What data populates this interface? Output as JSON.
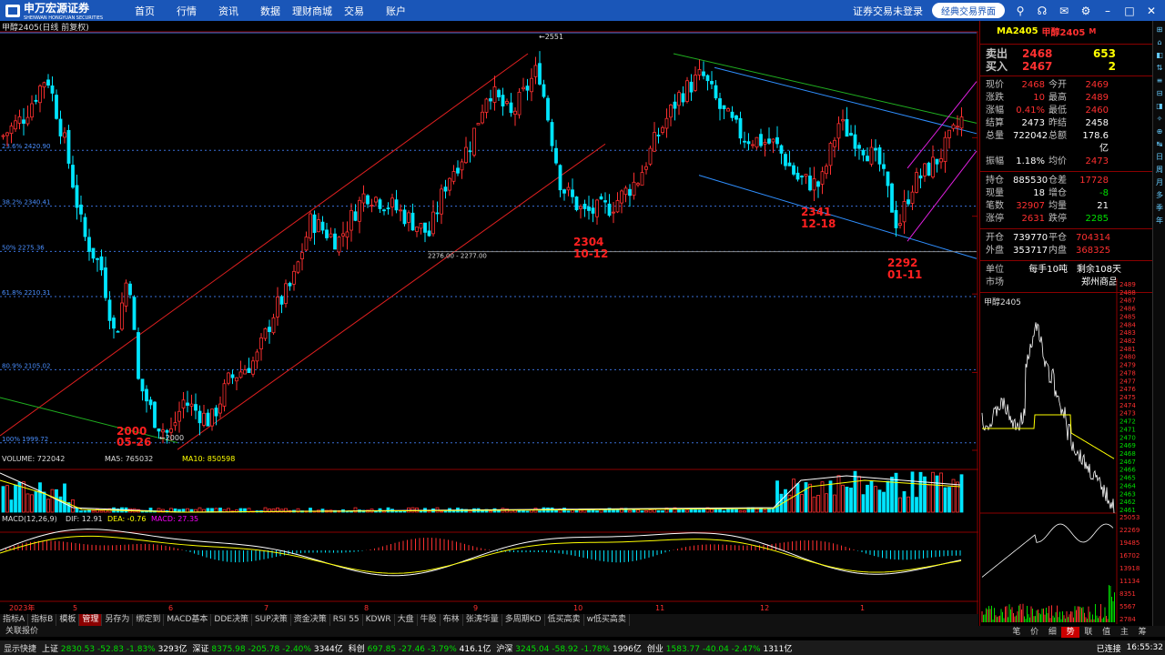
{
  "header": {
    "logo": "申万宏源证券",
    "logo_sub": "SHENWAN HONGYUAN SECURITIES",
    "nav": [
      "首页",
      "行情",
      "资讯",
      "数据",
      "理财商城",
      "交易",
      "账户"
    ],
    "login_status": "证券交易未登录",
    "classic_button": "经典交易界面",
    "icons": [
      "search-icon",
      "headset-icon",
      "mail-icon",
      "gear-icon",
      "minimize-icon",
      "maximize-icon",
      "close-icon"
    ]
  },
  "chart": {
    "info": "甲醇2405(日线 前复权)",
    "fib_levels": [
      {
        "label": "23.6% 2420.90",
        "price": 2420.9
      },
      {
        "label": "38.2% 2340.41",
        "price": 2340.41
      },
      {
        "label": "50% 2275.36",
        "price": 2275.36
      },
      {
        "label": "61.8% 2210.31",
        "price": 2210.31
      },
      {
        "label": "80.9% 2105.02",
        "price": 2105.02
      },
      {
        "label": "100% 1999.72",
        "price": 1999.72
      }
    ],
    "right_axis": [
      {
        "label": "2439",
        "price": 2439
      },
      {
        "label": "2326",
        "price": 2326
      },
      {
        "label": "2214",
        "price": 2214
      },
      {
        "label": "2101",
        "price": 2101
      },
      {
        "label": "1989",
        "price": 1989
      }
    ],
    "annotations": [
      {
        "text": "2000",
        "price": 2000
      },
      {
        "text": "05-26",
        "price": 2000
      },
      {
        "text": "2304",
        "price": 2304
      },
      {
        "text": "10-12",
        "price": 2304
      },
      {
        "text": "2341",
        "price": 2341
      },
      {
        "text": "12-18",
        "price": 2341
      },
      {
        "text": "2292",
        "price": 2292
      },
      {
        "text": "01-11",
        "price": 2292
      }
    ],
    "marks": {
      "high": "2551",
      "low": "2000",
      "gap": "2276.00 - 2277.00"
    },
    "x_labels": [
      "2023年",
      "5",
      "6",
      "7",
      "8",
      "9",
      "10",
      "11",
      "12",
      "1"
    ],
    "period": "日线",
    "volume_info": {
      "title": "VOLUME: 722042",
      "ma5": "MA5: 765032",
      "ma10": "MA10: 850598"
    },
    "volume_axis": [
      "15000",
      "10000",
      "5000",
      "X100"
    ],
    "macd_info": {
      "title": "MACD(12,26,9)",
      "dif": "DIF: 12.91",
      "dea": "DEA: -0.76",
      "macd": "MACD: 27.35"
    },
    "macd_axis": [
      "50.00",
      "0.00",
      "-50.00"
    ]
  },
  "quote": {
    "code": "MA2405",
    "name": "甲醇2405",
    "flag": "M",
    "sell": {
      "label": "卖出",
      "price": "2468",
      "vol": "653"
    },
    "buy": {
      "label": "买入",
      "price": "2467",
      "vol": "2"
    },
    "rows": [
      [
        "现价",
        "2468",
        "今开",
        "2469"
      ],
      [
        "涨跌",
        "10",
        "最高",
        "2489"
      ],
      [
        "涨幅",
        "0.41%",
        "最低",
        "2460"
      ],
      [
        "结算",
        "2473",
        "昨结",
        "2458"
      ],
      [
        "总量",
        "722042",
        "总额",
        "178.6亿"
      ],
      [
        "振幅",
        "1.18%",
        "均价",
        "2473"
      ]
    ],
    "rows2": [
      [
        "持仓",
        "885530",
        "仓差",
        "17728"
      ],
      [
        "现量",
        "18",
        "增仓",
        "-8"
      ],
      [
        "笔数",
        "32907",
        "均量",
        "21"
      ],
      [
        "涨停",
        "2631",
        "跌停",
        "2285"
      ]
    ],
    "rows3": [
      [
        "开仓",
        "739770",
        "平仓",
        "704314"
      ],
      [
        "外盘",
        "353717",
        "内盘",
        "368325"
      ]
    ],
    "unit": {
      "label": "单位",
      "value": "每手10吨",
      "remain": "剩余108天"
    },
    "market": {
      "label": "市场",
      "value": "郑州商品"
    },
    "mini_title": "甲醇2405",
    "mini_price_axis": [
      "2489",
      "2488",
      "2487",
      "2486",
      "2485",
      "2484",
      "2483",
      "2482",
      "2481",
      "2480",
      "2479",
      "2478",
      "2477",
      "2476",
      "2475",
      "2474",
      "2473",
      "2472",
      "2471",
      "2470",
      "2469",
      "2468",
      "2467",
      "2466",
      "2465",
      "2464",
      "2463",
      "2462",
      "2461"
    ],
    "mini_vol_axis": [
      "25053",
      "22269",
      "19485",
      "16702",
      "13918",
      "11134",
      "8351",
      "5567",
      "2784"
    ]
  },
  "right_toolbar": [
    "日",
    "周",
    "月",
    "多",
    "季",
    "年"
  ],
  "bottom_tabs": [
    "指标A",
    "指标B",
    "模板",
    "管理",
    "另存为",
    "绑定到",
    "MACD基本",
    "DDE决策",
    "SUP决策",
    "资金决策",
    "RSI 55",
    "KDWR",
    "大盘",
    "牛股",
    "布林",
    "张涛华量",
    "多周期KD",
    "低买高卖",
    "w低买高卖"
  ],
  "active_tab": "管理",
  "row2_label": "关联报价",
  "side_tabs": [
    "笔",
    "价",
    "细",
    "势",
    "联",
    "值",
    "主",
    "筹"
  ],
  "active_side_tab": "势",
  "status": {
    "quick": "显示快捷",
    "items": [
      {
        "label": "上证",
        "value": "2830.53",
        "chg": "-52.83",
        "pct": "-1.83%",
        "amt": "3293亿"
      },
      {
        "label": "深证",
        "value": "8375.98",
        "chg": "-205.78",
        "pct": "-2.40%",
        "amt": "3344亿"
      },
      {
        "label": "科创",
        "value": "697.85",
        "chg": "-27.46",
        "pct": "-3.79%",
        "amt": "416.1亿"
      },
      {
        "label": "沪深",
        "value": "3245.04",
        "chg": "-58.92",
        "pct": "-1.78%",
        "amt": "1996亿"
      },
      {
        "label": "创业",
        "value": "1583.77",
        "chg": "-40.04",
        "pct": "-2.47%",
        "amt": "1311亿"
      }
    ],
    "connected": "已连接",
    "time": "16:55:32"
  },
  "colors": {
    "up": "#ff3030",
    "down": "#00e5ff",
    "accent": "#1a56b8"
  }
}
